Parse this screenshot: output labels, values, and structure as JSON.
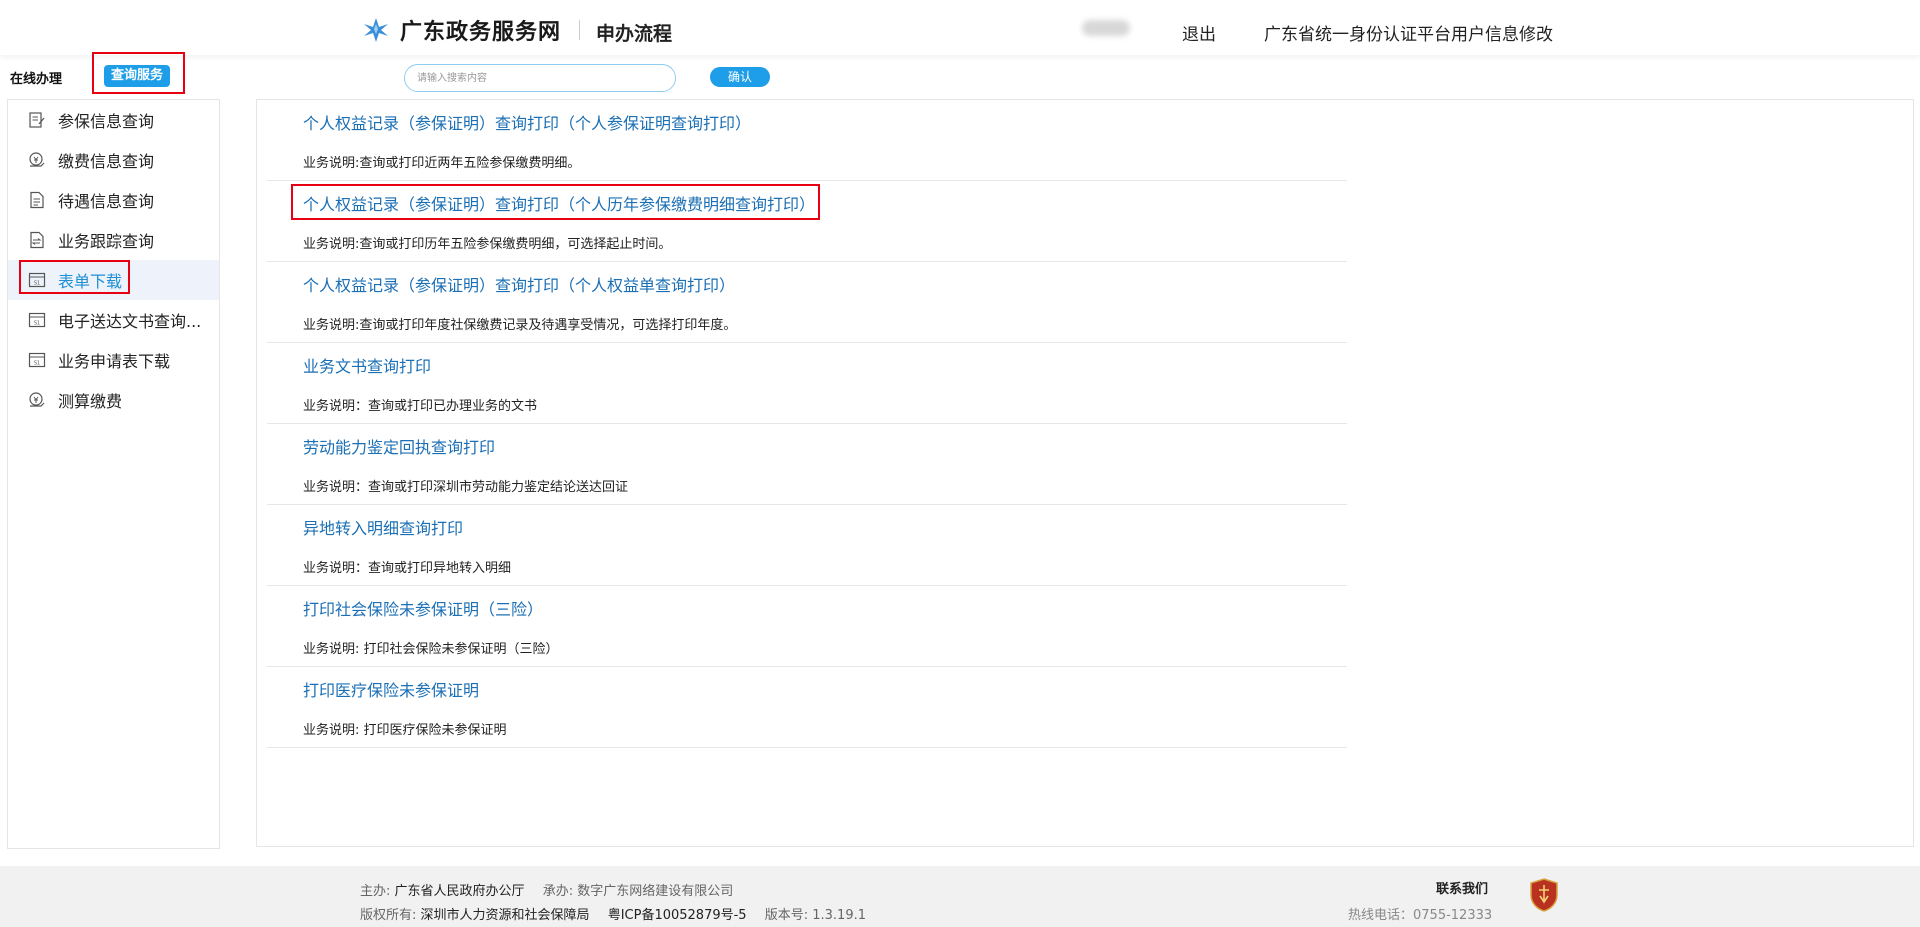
{
  "header": {
    "site_name": "广东政务服务网",
    "process_name": "申办流程",
    "logout": "退出",
    "profile_edit": "广东省统一身份认证平台用户信息修改"
  },
  "tabs": {
    "online_label": "在线办理",
    "query_service": "查询服务"
  },
  "search": {
    "placeholder": "请输入搜索内容",
    "confirm": "确认"
  },
  "sidebar": {
    "items": [
      {
        "label": "参保信息查询",
        "icon": "edit-document-icon"
      },
      {
        "label": "缴费信息查询",
        "icon": "payment-icon"
      },
      {
        "label": "待遇信息查询",
        "icon": "document-list-icon"
      },
      {
        "label": "业务跟踪查询",
        "icon": "transfer-document-icon"
      },
      {
        "label": "表单下载",
        "icon": "form-icon"
      },
      {
        "label": "电子送达文书查询...",
        "icon": "form-icon"
      },
      {
        "label": "业务申请表下载",
        "icon": "form-icon"
      },
      {
        "label": "测算缴费",
        "icon": "payment-icon"
      }
    ],
    "active_index": 4
  },
  "services": [
    {
      "title": "个人权益记录（参保证明）查询打印（个人参保证明查询打印）",
      "desc": "业务说明:查询或打印近两年五险参保缴费明细。"
    },
    {
      "title": "个人权益记录（参保证明）查询打印（个人历年参保缴费明细查询打印）",
      "desc": "业务说明:查询或打印历年五险参保缴费明细，可选择起止时间。"
    },
    {
      "title": "个人权益记录（参保证明）查询打印（个人权益单查询打印）",
      "desc": "业务说明:查询或打印年度社保缴费记录及待遇享受情况，可选择打印年度。"
    },
    {
      "title": "业务文书查询打印",
      "desc": "业务说明：查询或打印已办理业务的文书"
    },
    {
      "title": "劳动能力鉴定回执查询打印",
      "desc": "业务说明：查询或打印深圳市劳动能力鉴定结论送达回证"
    },
    {
      "title": "异地转入明细查询打印",
      "desc": "业务说明：查询或打印异地转入明细"
    },
    {
      "title": "打印社会保险未参保证明（三险）",
      "desc": "业务说明: 打印社会保险未参保证明（三险）"
    },
    {
      "title": "打印医疗保险未参保证明",
      "desc": "业务说明: 打印医疗保险未参保证明"
    }
  ],
  "footer": {
    "host_label": "主办:",
    "host": "广东省人民政府办公厅",
    "undertake_label": "承办:",
    "undertake": "数字广东网络建设有限公司",
    "copyright_label": "版权所有:",
    "copyright": "深圳市人力资源和社会保障局",
    "icp": "粤ICP备10052879号-5",
    "version_label": "版本号:",
    "version": "1.3.19.1",
    "contact_title": "联系我们",
    "hotline": "热线电话：0755-12333"
  },
  "colors": {
    "accent": "#1e9ee8",
    "link": "#1b6fb5",
    "highlight": "#e60012"
  }
}
